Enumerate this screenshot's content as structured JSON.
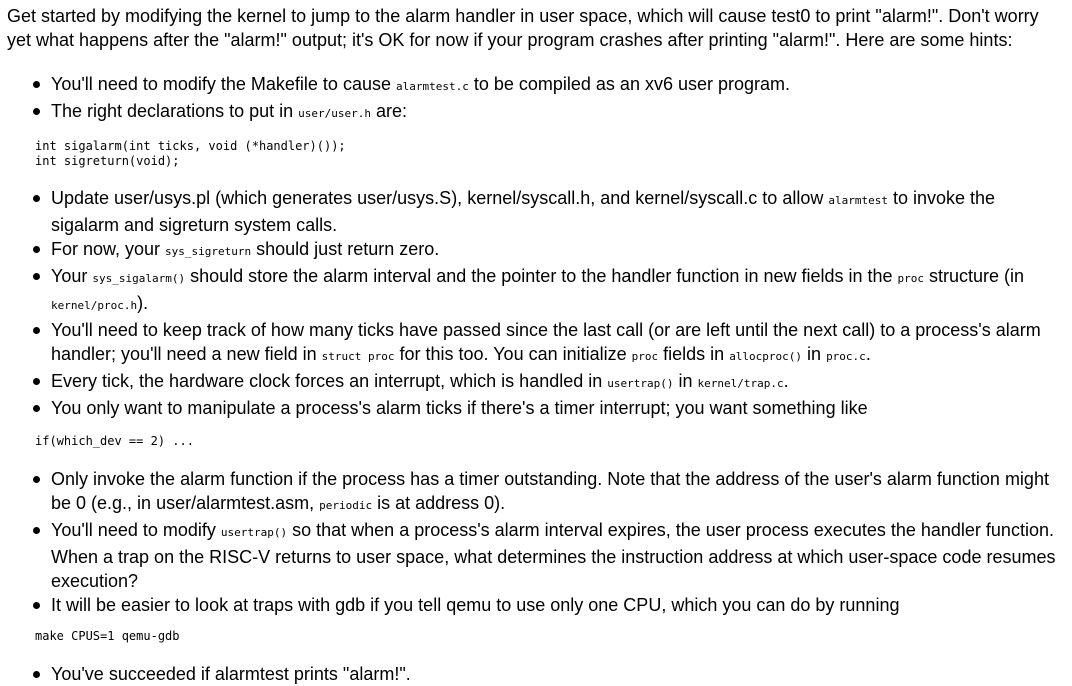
{
  "intro": "Get started by modifying the kernel to jump to the alarm handler in user space, which will cause test0 to print \"alarm!\". Don't worry yet what happens after the \"alarm!\" output; it's OK for now if your program crashes after printing \"alarm!\". Here are some hints:",
  "hints": {
    "h1": {
      "a": "You'll need to modify the Makefile to cause ",
      "code1": "alarmtest.c",
      "b": " to be compiled as an xv6 user program."
    },
    "h2": {
      "a": "The right declarations to put in ",
      "code1": "user/user.h",
      "b": " are:"
    },
    "decl_code": "int sigalarm(int ticks, void (*handler)());\nint sigreturn(void);",
    "h3": {
      "a": "Update user/usys.pl (which generates user/usys.S), kernel/syscall.h, and kernel/syscall.c to allow ",
      "code1": "alarmtest",
      "b": " to invoke the sigalarm and sigreturn system calls."
    },
    "h4": {
      "a": "For now, your ",
      "code1": "sys_sigreturn",
      "b": " should just return zero."
    },
    "h5": {
      "a": "Your ",
      "code1": "sys_sigalarm()",
      "b": " should store the alarm interval and the pointer to the handler function in new fields in the ",
      "code2": "proc",
      "c": " structure (in ",
      "code3": "kernel/proc.h",
      "d": ")."
    },
    "h6": {
      "a": "You'll need to keep track of how many ticks have passed since the last call (or are left until the next call) to a process's alarm handler; you'll need a new field in ",
      "code1": "struct proc",
      "b": " for this too. You can initialize ",
      "code2": "proc",
      "c": " fields in ",
      "code3": "allocproc()",
      "d": " in ",
      "code4": "proc.c",
      "e": "."
    },
    "h7": {
      "a": "Every tick, the hardware clock forces an interrupt, which is handled in ",
      "code1": "usertrap()",
      "b": " in ",
      "code2": "kernel/trap.c",
      "c": "."
    },
    "h8": {
      "a": "You only want to manipulate a process's alarm ticks if there's a timer interrupt; you want something like"
    },
    "if_code": "if(which_dev == 2) ...",
    "h9": {
      "a": "Only invoke the alarm function if the process has a timer outstanding. Note that the address of the user's alarm function might be 0 (e.g., in user/alarmtest.asm, ",
      "code1": "periodic",
      "b": " is at address 0)."
    },
    "h10": {
      "a": "You'll need to modify ",
      "code1": "usertrap()",
      "b": " so that when a process's alarm interval expires, the user process executes the handler function. When a trap on the RISC-V returns to user space, what determines the instruction address at which user-space code resumes execution?"
    },
    "h11": {
      "a": "It will be easier to look at traps with gdb if you tell qemu to use only one CPU, which you can do by running"
    },
    "make_code": "make CPUS=1 qemu-gdb",
    "h12": {
      "a": "You've succeeded if alarmtest prints \"alarm!\"."
    }
  }
}
